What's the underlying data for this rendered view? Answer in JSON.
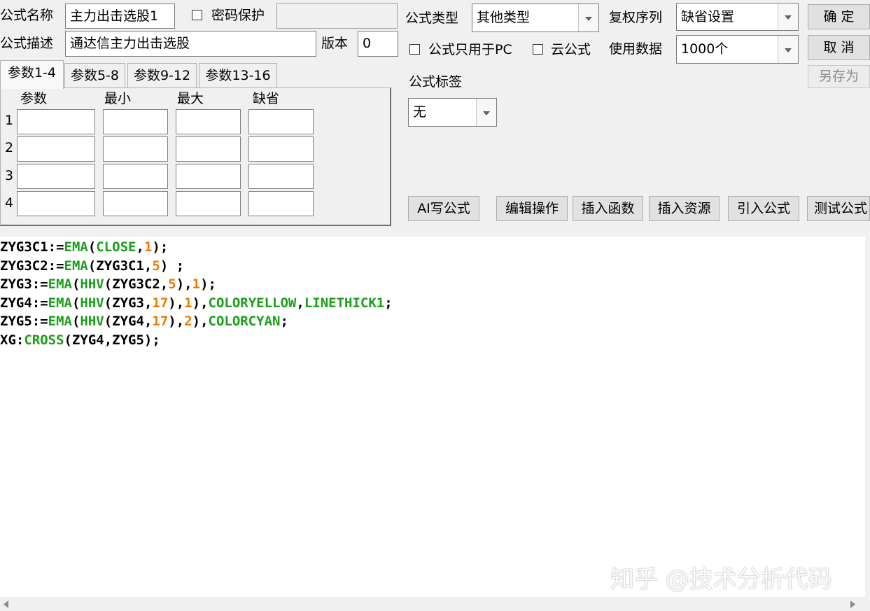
{
  "form": {
    "name_label": "公式名称",
    "name_value": "主力出击选股1",
    "password_label": "密码保护",
    "password_checked": false,
    "password_value": "",
    "desc_label": "公式描述",
    "desc_value": "通达信主力出击选股",
    "version_label": "版本",
    "version_value": "0"
  },
  "settings": {
    "type_label": "公式类型",
    "type_value": "其他类型",
    "rights_label": "复权序列",
    "rights_value": "缺省设置",
    "pc_only_label": "公式只用于PC",
    "pc_only_checked": false,
    "cloud_label": "云公式",
    "cloud_checked": false,
    "data_label": "使用数据",
    "data_value": "1000个",
    "tag_label": "公式标签",
    "tag_value": "无"
  },
  "buttons": {
    "ok": "确  定",
    "cancel": "取  消",
    "save_as": "另存为"
  },
  "tabs": [
    {
      "label": "参数1-4",
      "active": true
    },
    {
      "label": "参数5-8",
      "active": false
    },
    {
      "label": "参数9-12",
      "active": false
    },
    {
      "label": "参数13-16",
      "active": false
    }
  ],
  "params_table": {
    "headers": [
      "参数",
      "最小",
      "最大",
      "缺省"
    ],
    "rows": [
      {
        "index": "1",
        "values": [
          "",
          "",
          "",
          ""
        ]
      },
      {
        "index": "2",
        "values": [
          "",
          "",
          "",
          ""
        ]
      },
      {
        "index": "3",
        "values": [
          "",
          "",
          "",
          ""
        ]
      },
      {
        "index": "4",
        "values": [
          "",
          "",
          "",
          ""
        ]
      }
    ]
  },
  "toolbar": {
    "ai_write": "AI写公式",
    "edit_ops": "编辑操作",
    "insert_func": "插入函数",
    "insert_res": "插入资源",
    "import_formula": "引入公式",
    "test_formula": "测试公式"
  },
  "code_lines": [
    "ZYG3C1:=EMA(CLOSE,1);",
    "ZYG3C2:=EMA(ZYG3C1,5) ;",
    "ZYG3:=EMA(HHV(ZYG3C2,5),1);",
    "ZYG4:=EMA(HHV(ZYG3,17),1),COLORYELLOW,LINETHICK1;",
    "ZYG5:=EMA(HHV(ZYG4,17),2),COLORCYAN;",
    "XG:CROSS(ZYG4,ZYG5);"
  ],
  "syntax_keywords": [
    "EMA",
    "CLOSE",
    "HHV",
    "CROSS",
    "COLORYELLOW",
    "LINETHICK1",
    "COLORCYAN"
  ],
  "colors": {
    "keyword": "#1c9e1c",
    "number": "#f07800",
    "window_bg": "#f0f0f0"
  },
  "watermark": "知乎 @技术分析代码"
}
